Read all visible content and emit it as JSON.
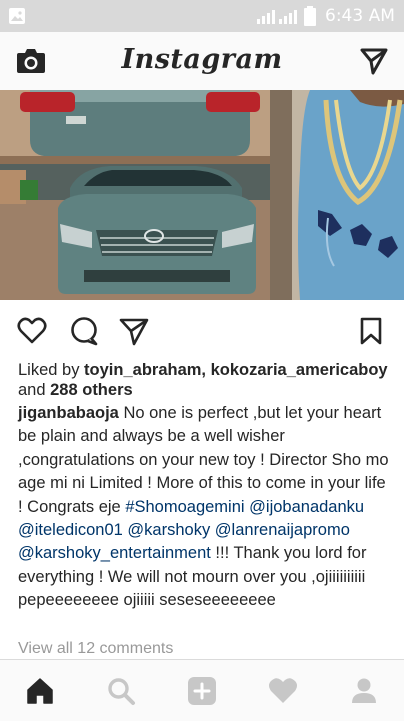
{
  "status_bar": {
    "time": "6:43 AM"
  },
  "app": {
    "title": "Instagram"
  },
  "post": {
    "liked_by_prefix": "Liked by ",
    "liked_user_1": "toyin_abraham",
    "liked_separator": ", ",
    "liked_user_2": "kokozaria_americaboy",
    "liked_and": "and ",
    "others_count": "288 others",
    "author": "jiganbabaoja",
    "caption_text_1": " No one is perfect ,but let your heart be plain and always be a well wisher ,congratulations on your new toy ! Director Sho mo age mi ni Limited ! More of this to come in your life ! Congrats eje ",
    "hashtag": "#Shomoagemini",
    "mention_1": "@ijobanadanku",
    "mention_2": "@iteledicon01",
    "mention_3": "@karshoky",
    "mention_4": "@lanrenaijapromo",
    "mention_5": "@karshoky_entertainment",
    "caption_text_2": " !!! Thank you lord for everything ! We will not mourn over you ,ojiiiiiiiiii pepeeeeeeee ojiiiii seseseeeeeeee",
    "view_comments": "View all 12 comments"
  },
  "colors": {
    "link": "#003569",
    "muted": "#999999",
    "text": "#262626"
  }
}
